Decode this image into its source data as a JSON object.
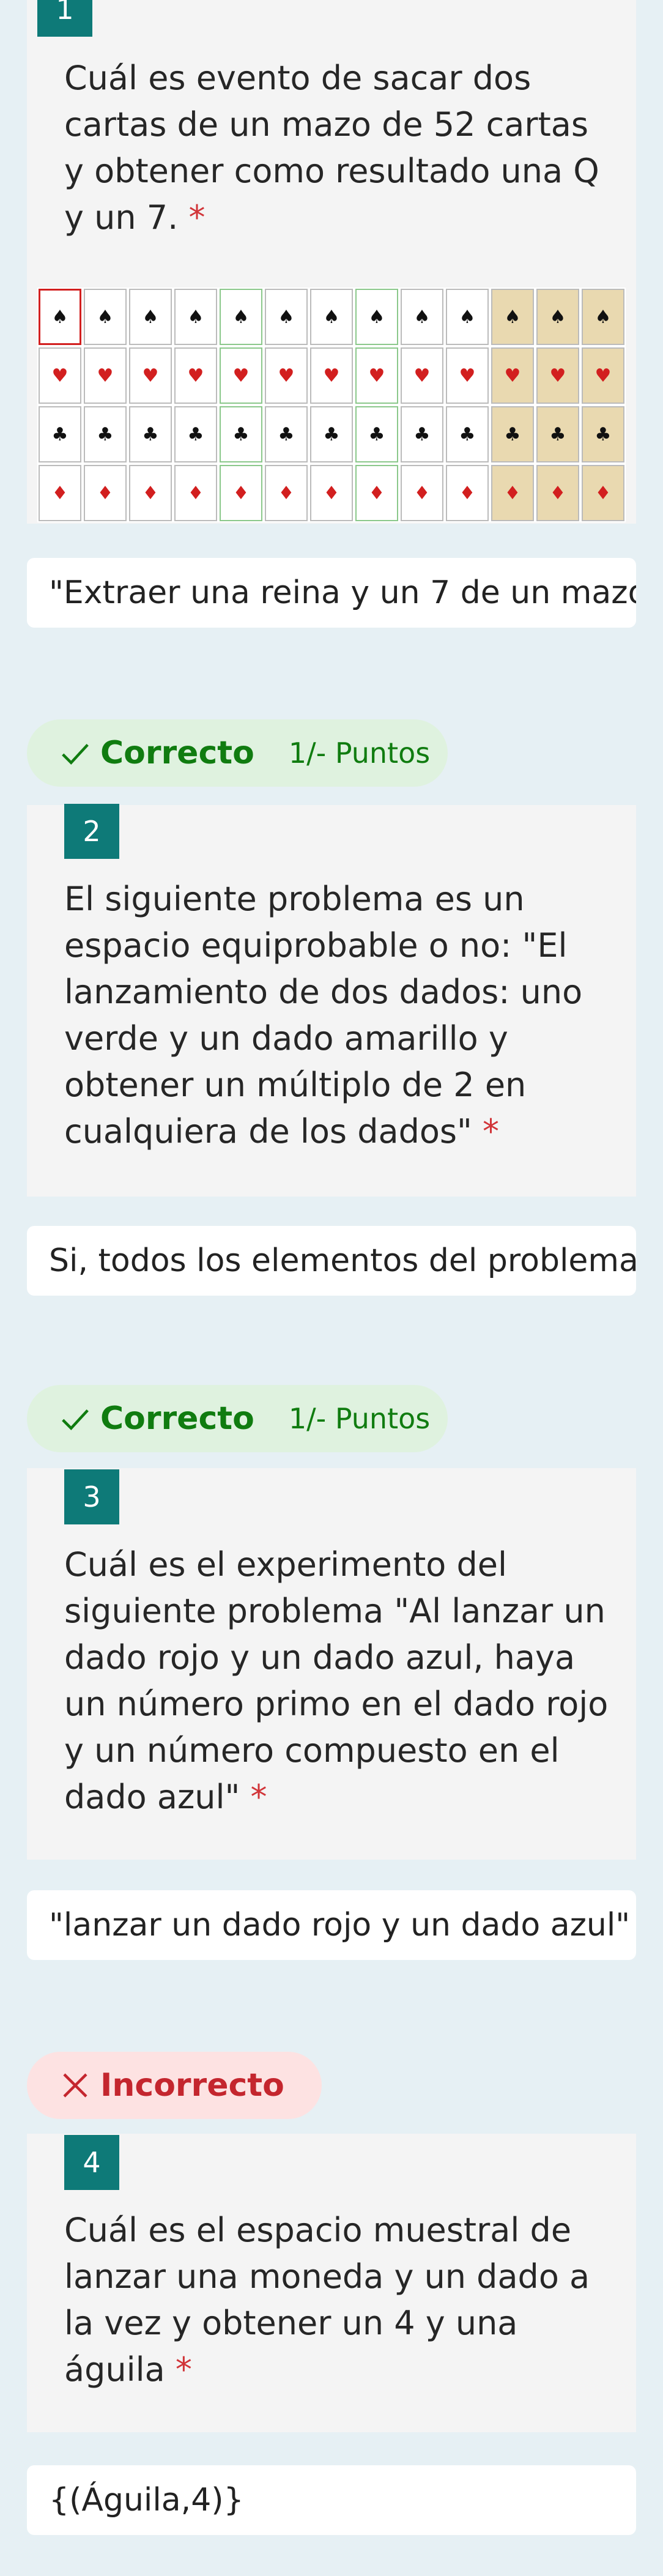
{
  "questions": [
    {
      "number": "1",
      "text": "Cuál es evento de sacar dos cartas de un mazo de 52 cartas y obtener como resultado una Q y un 7.",
      "required_mark": "*",
      "image_alt": "deck-of-52-cards",
      "answer": "\"Extraer una reina y un 7 de un mazo"
    },
    {
      "number": "2",
      "text": "El siguiente problema es un espacio equiprobable o no: \"El lanzamiento de dos dados: uno verde y un dado amarillo y obtener un múltiplo de 2 en cualquiera de los dados\"",
      "required_mark": "*",
      "answer": "Si, todos los elementos del problema",
      "result": {
        "label": "Correcto",
        "points": "1/- Puntos",
        "status": "correct"
      }
    },
    {
      "number": "3",
      "text": "Cuál es el experimento del siguiente problema \"Al lanzar un dado rojo y un dado azul, haya un número primo en el dado rojo y un número compuesto en el dado azul\"",
      "required_mark": "*",
      "answer": "\"lanzar un dado rojo y un dado azul\"",
      "result": {
        "label": "Correcto",
        "points": "1/- Puntos",
        "status": "correct"
      }
    },
    {
      "number": "4",
      "text": "Cuál es el espacio muestral de lanzar una moneda y un dado a la vez y obtener un 4 y una águila",
      "required_mark": "*",
      "answer": "{(Águila,4)}",
      "result": {
        "label": "Incorrecto",
        "status": "incorrect"
      }
    }
  ],
  "pre_q2_badge": {
    "label": "Correcto",
    "points": "1/- Puntos"
  },
  "colors": {
    "accent": "#0e7a78",
    "correct": "#107c10",
    "incorrect": "#c4262e",
    "required": "#d13438"
  },
  "icons": {
    "correct": "check-icon",
    "incorrect": "x-icon"
  }
}
